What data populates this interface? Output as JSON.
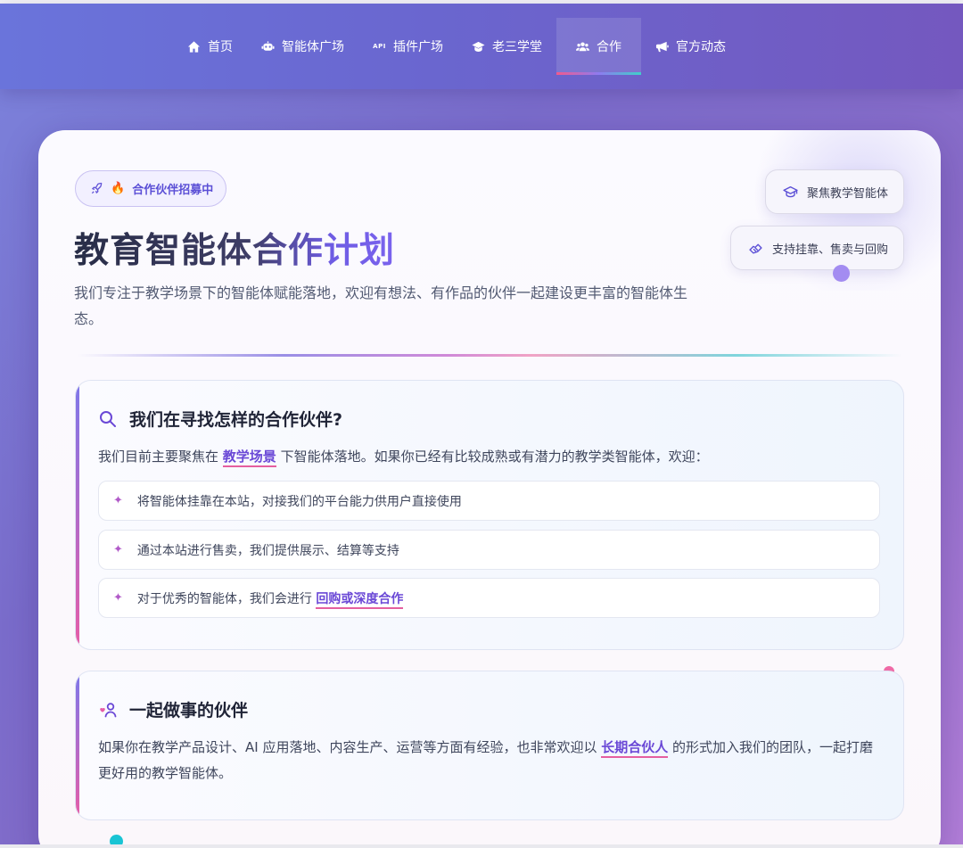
{
  "nav": {
    "items": [
      {
        "label": "首页",
        "icon": "home-icon"
      },
      {
        "label": "智能体广场",
        "icon": "robot-icon"
      },
      {
        "label": "插件广场",
        "icon": "api-icon",
        "badge": "API"
      },
      {
        "label": "老三学堂",
        "icon": "graduation-cap-icon"
      },
      {
        "label": "合作",
        "icon": "users-icon",
        "active": true
      },
      {
        "label": "官方动态",
        "icon": "megaphone-icon"
      }
    ]
  },
  "hero": {
    "badge": "合作伙伴招募中",
    "title": "教育智能体合作计划",
    "subtitle": "我们专注于教学场景下的智能体赋能落地，欢迎有想法、有作品的伙伴一起建设更丰富的智能体生态。",
    "pills": [
      "聚焦教学智能体",
      "支持挂靠、售卖与回购"
    ]
  },
  "section1": {
    "title": "我们在寻找怎样的合作伙伴?",
    "intro_before": "我们目前主要聚焦在",
    "intro_highlight": "教学场景",
    "intro_after": "下智能体落地。如果你已经有比较成熟或有潜力的教学类智能体，欢迎：",
    "items": [
      "将智能体挂靠在本站，对接我们的平台能力供用户直接使用",
      "通过本站进行售卖，我们提供展示、结算等支持",
      "对于优秀的智能体，我们会进行"
    ],
    "item3_highlight": "回购或深度合作",
    "bullet": "✦"
  },
  "section2": {
    "title": "一起做事的伙伴",
    "text_before": "如果你在教学产品设计、AI 应用落地、内容生产、运营等方面有经验，也非常欢迎以",
    "text_highlight": "长期合伙人",
    "text_after": "的形式加入我们的团队，一起打磨更好用的教学智能体。"
  },
  "colors": {
    "accent": "#6a48d6",
    "underline": "#e55f9f",
    "nav_bg": "#6a66cf"
  }
}
